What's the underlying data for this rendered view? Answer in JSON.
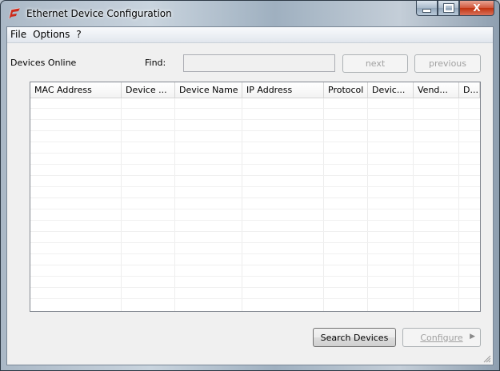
{
  "window": {
    "title": "Ethernet Device Configuration",
    "accent": "#cc2a1a"
  },
  "caption_buttons": {
    "close_label": "X"
  },
  "menu": {
    "items": [
      "File",
      "Options",
      "?"
    ]
  },
  "toolbar": {
    "devices_online_label": "Devices Online",
    "find_label": "Find:",
    "find_value": "",
    "next_label": "next",
    "previous_label": "previous"
  },
  "table": {
    "columns": [
      "MAC Address",
      "Device ...",
      "Device Name",
      "IP Address",
      "Protocol",
      "Devic...",
      "Vend...",
      "D..."
    ],
    "rows": []
  },
  "footer": {
    "search_label": "Search Devices",
    "configure_label": "Configure"
  }
}
